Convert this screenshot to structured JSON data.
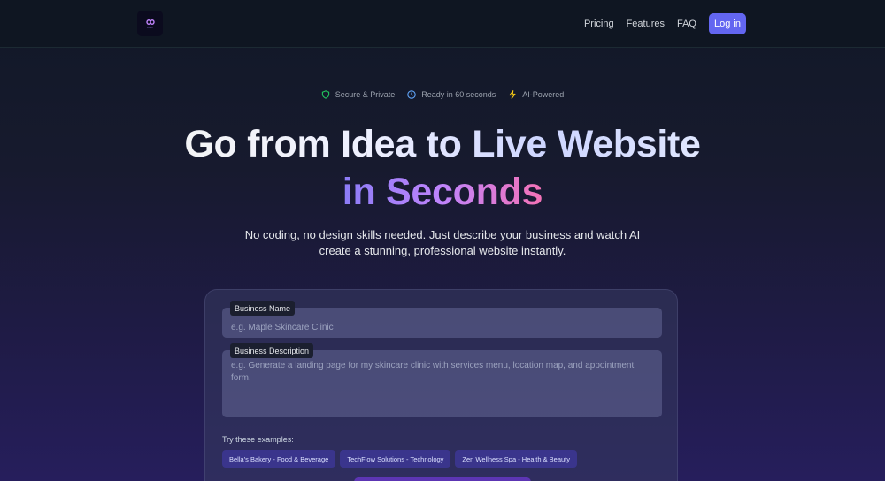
{
  "nav": {
    "logo_text": "LOGO",
    "links": [
      "Pricing",
      "Features",
      "FAQ"
    ],
    "login_label": "Log in"
  },
  "badges": [
    {
      "label": "Secure & Private",
      "icon": "shield-icon",
      "color": "#22c55e"
    },
    {
      "label": "Ready in 60 seconds",
      "icon": "clock-icon",
      "color": "#60a5fa"
    },
    {
      "label": "AI-Powered",
      "icon": "lightning-icon",
      "color": "#facc15"
    }
  ],
  "hero": {
    "title_line1": "Go from Idea to Live Website",
    "title_line2": "in Seconds",
    "subtitle": "No coding, no design skills needed. Just describe your business and watch AI create a stunning, professional website instantly."
  },
  "form": {
    "business_name": {
      "label": "Business Name",
      "placeholder": "e.g. Maple Skincare Clinic",
      "value": ""
    },
    "business_description": {
      "label": "Business Description",
      "placeholder": "e.g. Generate a landing page for my skincare clinic with services menu, location map, and appointment form.",
      "value": ""
    },
    "examples_label": "Try these examples:",
    "examples": [
      "Bella's Bakery - Food & Beverage",
      "TechFlow Solutions - Technology",
      "Zen Wellness Spa - Health & Beauty"
    ]
  },
  "colors": {
    "accent": "#6366f1",
    "gradient_start": "#8b7cf6",
    "gradient_end": "#f472b6"
  }
}
